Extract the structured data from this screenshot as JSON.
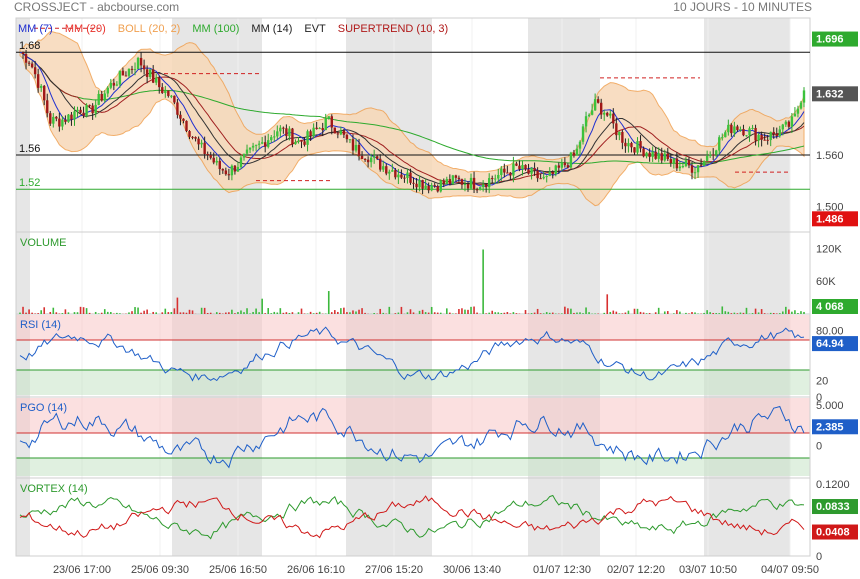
{
  "header": {
    "title": "CROSSJECT - abcbourse.com",
    "period": "10 JOURS - 10 MINUTES"
  },
  "legend": [
    {
      "label": "MM (7)",
      "color": "#1f2fd0"
    },
    {
      "label": "MM (20)",
      "color": "#e8322c"
    },
    {
      "label": "BOLL (20, 2)",
      "color": "#f0a050"
    },
    {
      "label": "MM (100)",
      "color": "#2eaa2e"
    },
    {
      "label": "MM (14)",
      "color": "#222222"
    },
    {
      "label": "EVT",
      "color": "#222222"
    },
    {
      "label": "SUPERTREND (10, 3)",
      "color": "#b01818"
    }
  ],
  "chart_data": [
    {
      "type": "candlestick",
      "panel": "price",
      "ylim": [
        1.47,
        1.72
      ],
      "y_ticks": [
        "1.696",
        "1.632",
        "1.560",
        "1.500"
      ],
      "levels": [
        {
          "label": "1.68",
          "value": 1.68,
          "color": "#111111"
        },
        {
          "label": "1.56",
          "value": 1.56,
          "color": "#111111"
        },
        {
          "label": "1.52",
          "value": 1.52,
          "color": "#2eaa2e"
        }
      ],
      "value_tags": [
        {
          "text": "1.696",
          "value": 1.696,
          "color": "#2eaa2e"
        },
        {
          "text": "1.632",
          "value": 1.632,
          "color": "#555555"
        },
        {
          "text": "1.486",
          "value": 1.486,
          "color": "#e01010"
        }
      ],
      "x_labels": [
        "23/06 17:00",
        "25/06 09:30",
        "25/06 16:50",
        "26/06 16:10",
        "27/06 15:20",
        "30/06 13:40",
        "01/07 12:30",
        "02/07 12:20",
        "03/07 10:50",
        "04/07 09:50"
      ],
      "close_path": [
        1.68,
        1.67,
        1.64,
        1.6,
        1.6,
        1.605,
        1.615,
        1.61,
        1.625,
        1.64,
        1.65,
        1.66,
        1.67,
        1.655,
        1.64,
        1.63,
        1.61,
        1.59,
        1.57,
        1.56,
        1.545,
        1.54,
        1.55,
        1.56,
        1.57,
        1.58,
        1.59,
        1.585,
        1.575,
        1.58,
        1.59,
        1.6,
        1.59,
        1.575,
        1.565,
        1.56,
        1.55,
        1.545,
        1.54,
        1.535,
        1.53,
        1.525,
        1.525,
        1.528,
        1.53,
        1.528,
        1.526,
        1.53,
        1.535,
        1.54,
        1.545,
        1.54,
        1.535,
        1.53,
        1.54,
        1.55,
        1.56,
        1.6,
        1.62,
        1.61,
        1.59,
        1.575,
        1.57,
        1.565,
        1.56,
        1.555,
        1.55,
        1.548,
        1.545,
        1.555,
        1.57,
        1.585,
        1.595,
        1.59,
        1.585,
        1.58,
        1.585,
        1.59,
        1.6,
        1.64
      ]
    },
    {
      "type": "bar",
      "panel": "volume",
      "title": "VOLUME",
      "y_ticks": [
        "120K",
        "60K"
      ],
      "ylim": [
        0,
        150000
      ],
      "value_tag": "4 068",
      "spikes": [
        {
          "at": 0.59,
          "value": 118000
        },
        {
          "at": 0.395,
          "value": 42000
        },
        {
          "at": 0.75,
          "value": 36000
        },
        {
          "at": 0.2,
          "value": 30000
        },
        {
          "at": 0.31,
          "value": 28000
        }
      ]
    },
    {
      "type": "line",
      "panel": "rsi",
      "title": "RSI (14)",
      "y_ticks": [
        "80.00",
        "20",
        "0"
      ],
      "ylim": [
        0,
        100
      ],
      "bands": [
        70,
        30
      ],
      "value_tag": "64.94",
      "color": "#1f5fc8"
    },
    {
      "type": "line",
      "panel": "pgo",
      "title": "PGO (14)",
      "y_ticks": [
        "5.000",
        "0"
      ],
      "ylim": [
        -4,
        6
      ],
      "value_tag": "2.385",
      "color": "#1f5fc8"
    },
    {
      "type": "line",
      "panel": "vortex",
      "title": "VORTEX (14)",
      "y_ticks": [
        "0.1200",
        "0"
      ],
      "ylim": [
        0,
        0.13
      ],
      "series": [
        {
          "name": "green",
          "tag": "0.0833",
          "color": "#2e9a2e"
        },
        {
          "name": "red",
          "tag": "0.0408",
          "color": "#d01818"
        }
      ]
    }
  ]
}
